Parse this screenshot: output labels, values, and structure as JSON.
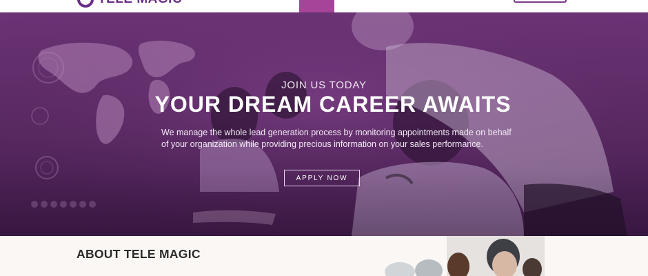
{
  "brand": {
    "name": "TELE MAGIC",
    "colors": {
      "primary": "#6b2f86",
      "accent": "#a6449a"
    }
  },
  "hero": {
    "kicker": "JOIN US TODAY",
    "headline": "YOUR DREAM CAREER AWAITS",
    "description": "We manage the whole lead generation process by monitoring appointments made on behalf of your organization while providing precious information on your sales performance.",
    "cta_label": "APPLY NOW"
  },
  "about": {
    "title": "ABOUT TELE MAGIC"
  }
}
